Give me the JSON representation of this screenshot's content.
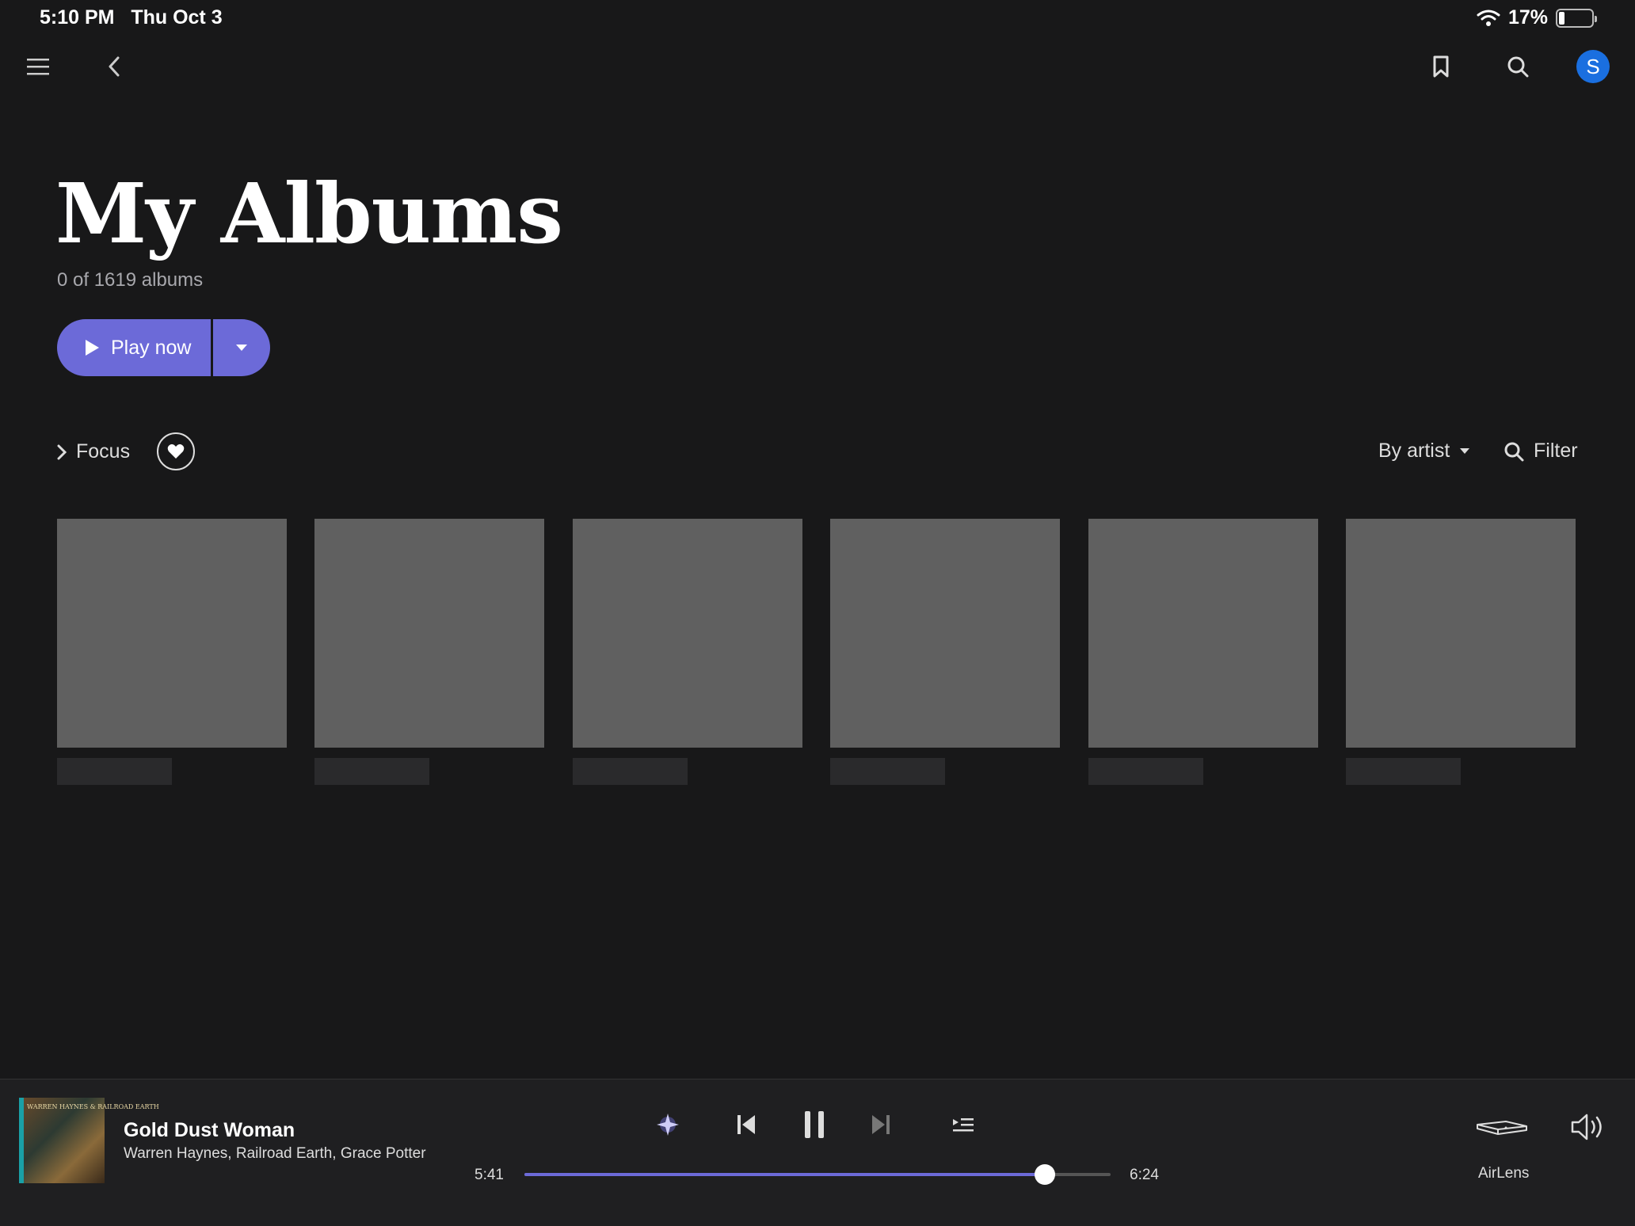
{
  "status_bar": {
    "time": "5:10 PM",
    "date": "Thu Oct 3",
    "battery_percent": "17%",
    "battery_level": 0.17
  },
  "header": {
    "icons": [
      "menu-icon",
      "back-icon",
      "bookmark-icon",
      "search-icon"
    ],
    "avatar_initial": "S"
  },
  "page": {
    "title": "My Albums",
    "count_text": "0 of 1619 albums",
    "play_now_label": "Play now",
    "focus_label": "Focus",
    "sort_label": "By artist",
    "filter_label": "Filter"
  },
  "albums": {
    "placeholder_count": 6
  },
  "player": {
    "track_title": "Gold Dust Woman",
    "track_artists": "Warren Haynes, Railroad Earth, Grace Potter",
    "elapsed": "5:41",
    "duration": "6:24",
    "progress_fraction": 0.888,
    "device_label": "AirLens",
    "cover_text": "WARREN HAYNES & RAILROAD EARTH"
  },
  "colors": {
    "background": "#181819",
    "accent": "#6c6ad8",
    "avatar": "#1a6fe0",
    "placeholder": "#606060"
  }
}
